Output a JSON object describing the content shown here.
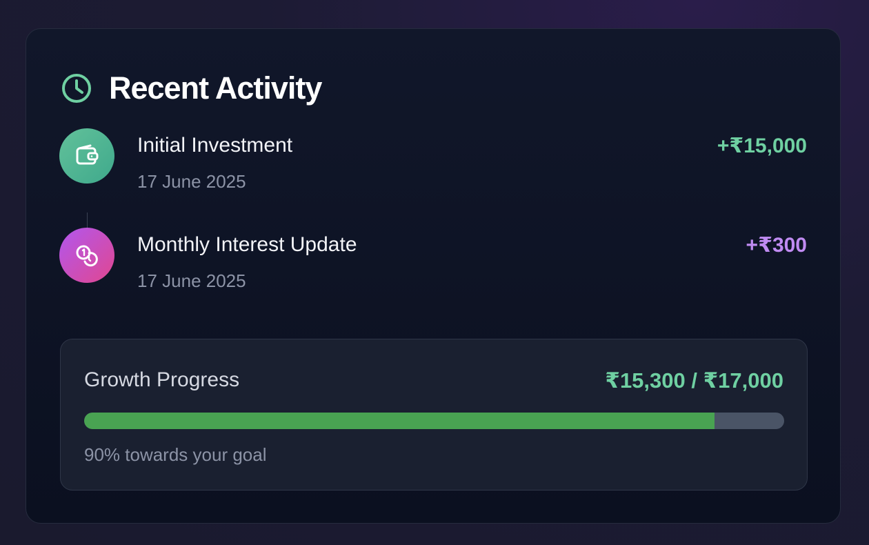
{
  "header": {
    "title": "Recent Activity",
    "icon": "clock-icon",
    "accent": "#6fd0a2"
  },
  "activities": [
    {
      "name": "Initial Investment",
      "date": "17 June 2025",
      "amount": "+₹15,000",
      "icon": "wallet-icon",
      "amount_color": "#6fd0a2"
    },
    {
      "name": "Monthly Interest Update",
      "date": "17 June 2025",
      "amount": "+₹300",
      "icon": "coins-icon",
      "amount_color": "#c08bf2"
    }
  ],
  "progress": {
    "label": "Growth Progress",
    "value": "₹15,300 / ₹17,000",
    "fraction": 0.9,
    "caption": "90% towards your goal",
    "fill_color": "#49a352"
  }
}
